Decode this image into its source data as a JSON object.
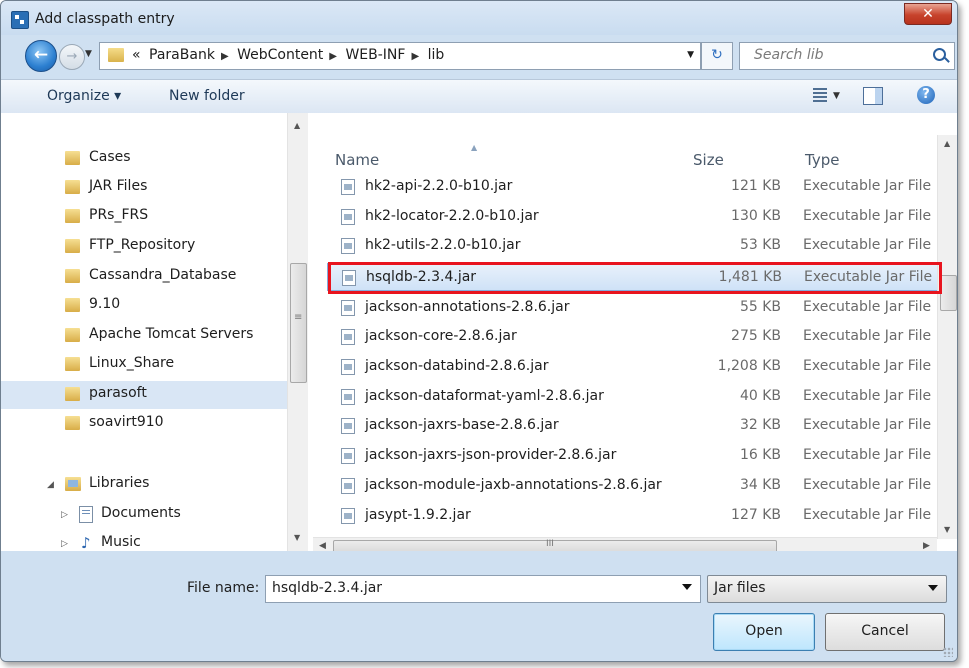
{
  "window": {
    "title": "Add classpath entry",
    "close_glyph": "✕"
  },
  "address": {
    "crumb_prefix": "«",
    "crumbs": [
      "ParaBank",
      "WebContent",
      "WEB-INF",
      "lib"
    ],
    "search_placeholder": "Search lib"
  },
  "toolbar": {
    "organize_label": "Organize ▾",
    "new_folder_label": "New folder",
    "help_glyph": "?"
  },
  "nav": {
    "folders": [
      "Cases",
      "JAR Files",
      "PRs_FRS",
      "FTP_Repository",
      "Cassandra_Database",
      "9.10",
      "Apache Tomcat Servers",
      "Linux_Share",
      "parasoft",
      "soavirt910"
    ],
    "selected_folder": "parasoft",
    "libraries_label": "Libraries",
    "library_items": [
      "Documents",
      "Music"
    ]
  },
  "files": {
    "columns": {
      "name": "Name",
      "size": "Size",
      "type": "Type"
    },
    "rows": [
      {
        "name": "hk2-api-2.2.0-b10.jar",
        "size": "121 KB",
        "type": "Executable Jar File"
      },
      {
        "name": "hk2-locator-2.2.0-b10.jar",
        "size": "130 KB",
        "type": "Executable Jar File"
      },
      {
        "name": "hk2-utils-2.2.0-b10.jar",
        "size": "53 KB",
        "type": "Executable Jar File"
      },
      {
        "name": "hsqldb-2.3.4.jar",
        "size": "1,481 KB",
        "type": "Executable Jar File"
      },
      {
        "name": "jackson-annotations-2.8.6.jar",
        "size": "55 KB",
        "type": "Executable Jar File"
      },
      {
        "name": "jackson-core-2.8.6.jar",
        "size": "275 KB",
        "type": "Executable Jar File"
      },
      {
        "name": "jackson-databind-2.8.6.jar",
        "size": "1,208 KB",
        "type": "Executable Jar File"
      },
      {
        "name": "jackson-dataformat-yaml-2.8.6.jar",
        "size": "40 KB",
        "type": "Executable Jar File"
      },
      {
        "name": "jackson-jaxrs-base-2.8.6.jar",
        "size": "32 KB",
        "type": "Executable Jar File"
      },
      {
        "name": "jackson-jaxrs-json-provider-2.8.6.jar",
        "size": "16 KB",
        "type": "Executable Jar File"
      },
      {
        "name": "jackson-module-jaxb-annotations-2.8.6.jar",
        "size": "34 KB",
        "type": "Executable Jar File"
      },
      {
        "name": "jasypt-1.9.2.jar",
        "size": "127 KB",
        "type": "Executable Jar File"
      }
    ],
    "selected_file": "hsqldb-2.3.4.jar",
    "highlight_color": "#e8141e"
  },
  "footer": {
    "file_name_label": "File name:",
    "file_name_value": "hsqldb-2.3.4.jar",
    "filter_value": "Jar files",
    "open_label": "Open",
    "cancel_label": "Cancel"
  }
}
